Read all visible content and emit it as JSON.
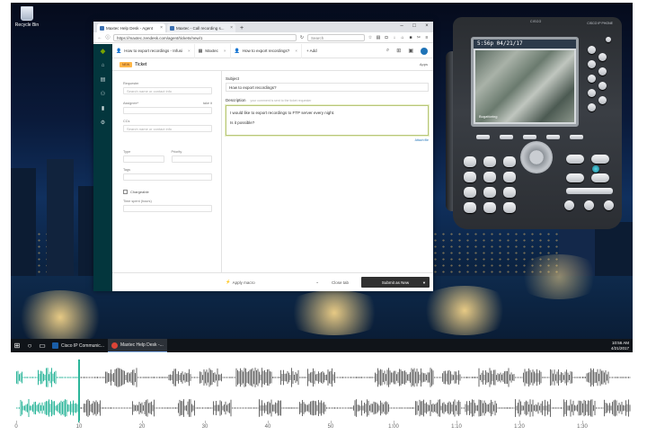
{
  "desktop": {
    "recycle_bin_label": "Recycle Bin"
  },
  "taskbar": {
    "apps": [
      {
        "label": "Cisco IP Communic...",
        "color": "#1a5ea8"
      },
      {
        "label": "Maxtec Help Desk -...",
        "color": "#db4437"
      }
    ],
    "time": "10:56 AM",
    "date": "4/21/2017"
  },
  "browser": {
    "tabs": [
      {
        "label": "Maxtec Help Desk - Agent"
      },
      {
        "label": "Maxtec - Call recording s..."
      }
    ],
    "url": "https://maxtec.zendesk.com/agent/tickets/new/1",
    "search_placeholder": "Search"
  },
  "zendesk": {
    "top_tabs": [
      {
        "label": "How to export recordings - Infusi"
      },
      {
        "label": "Maxtec"
      },
      {
        "label": "How to export recordings?"
      }
    ],
    "add_label": "+ Add",
    "new_badge": "NEW",
    "ticket_label": "Ticket",
    "apps_label": "Apps",
    "fields": {
      "requester_label": "Requester",
      "requester_placeholder": "Search name or contact info",
      "assignee_label": "Assignee*",
      "assignee_link": "take it",
      "ccs_label": "CCs",
      "ccs_placeholder": "Search name or contact info",
      "type_label": "Type",
      "priority_label": "Priority",
      "tags_label": "Tags",
      "chargeable_label": "Chargeable",
      "time_label": "Time spent (hours)"
    },
    "subject_label": "Subject",
    "subject_value": "How to export recordings?",
    "description_label": "Description",
    "description_hint": "your comment is sent to the ticket requester",
    "description_lines": [
      "I would like to export recordings to FTP server every night.",
      "Is it possible?"
    ],
    "attach_label": "Attach file",
    "apply_macro": "Apply macro",
    "close_tab": "Close tab",
    "submit": "Submit as New"
  },
  "phone": {
    "brand": "CISCO",
    "model": "CISCO IP PHONE",
    "screen_time": "5:56p 04/21/17",
    "screen_watermark": "Bugattoring"
  },
  "audio": {
    "accent_color": "#2bb59a",
    "wave_color": "#6a6a6a",
    "ticks": [
      "0",
      "10",
      "20",
      "30",
      "40",
      "50",
      "1:00",
      "1:10",
      "1:20",
      "1:30"
    ],
    "playhead_seconds": 10
  }
}
